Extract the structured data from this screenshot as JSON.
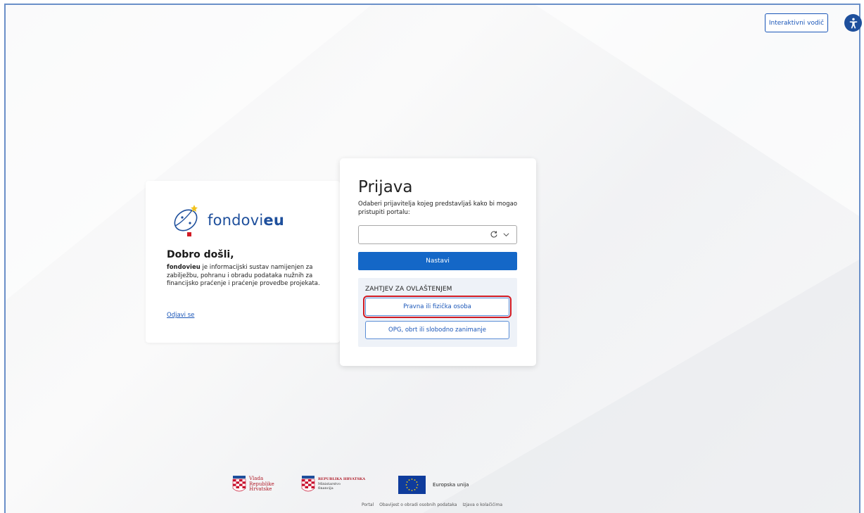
{
  "header": {
    "guide_label": "Interaktivni vodič"
  },
  "welcome": {
    "logo_text_plain": "fondovi",
    "logo_text_bold": "eu",
    "title": "Dobro došli,",
    "description_bold": "fondovieu",
    "description": " je informacijski sustav namijenjen za zabilježbu, pohranu i obradu podataka nužnih za financijsko praćenje i praćenje provedbe projekata.",
    "logout_label": "Odjavi se"
  },
  "login": {
    "title": "Prijava",
    "subtitle": "Odaberi prijavitelja kojeg predstavljaš kako bi mogao pristupiti portalu:",
    "applicant_select_value": "",
    "continue_label": "Nastavi",
    "auth_heading": "ZAHTJEV ZA OVLAŠTENJEM",
    "legal_person_label": "Pravna ili fizička osoba",
    "opg_label": "OPG, obrt ili slobodno zanimanje"
  },
  "footer": {
    "vlada_line1": "Vlada",
    "vlada_line2": "Republike",
    "vlada_line3": "Hrvatske",
    "minfin_line1": "REPUBLIKA HRVATSKA",
    "minfin_line2": "Ministarstvo",
    "minfin_line3": "financija",
    "eu_label": "Europska unija",
    "links": [
      "Portal",
      "Obavijest o obradi osobnih podataka",
      "Izjava o kolačićima"
    ]
  },
  "colors": {
    "primary": "#1467c7",
    "brand_blue": "#1e4f9c",
    "highlight_red": "#d11b24"
  }
}
